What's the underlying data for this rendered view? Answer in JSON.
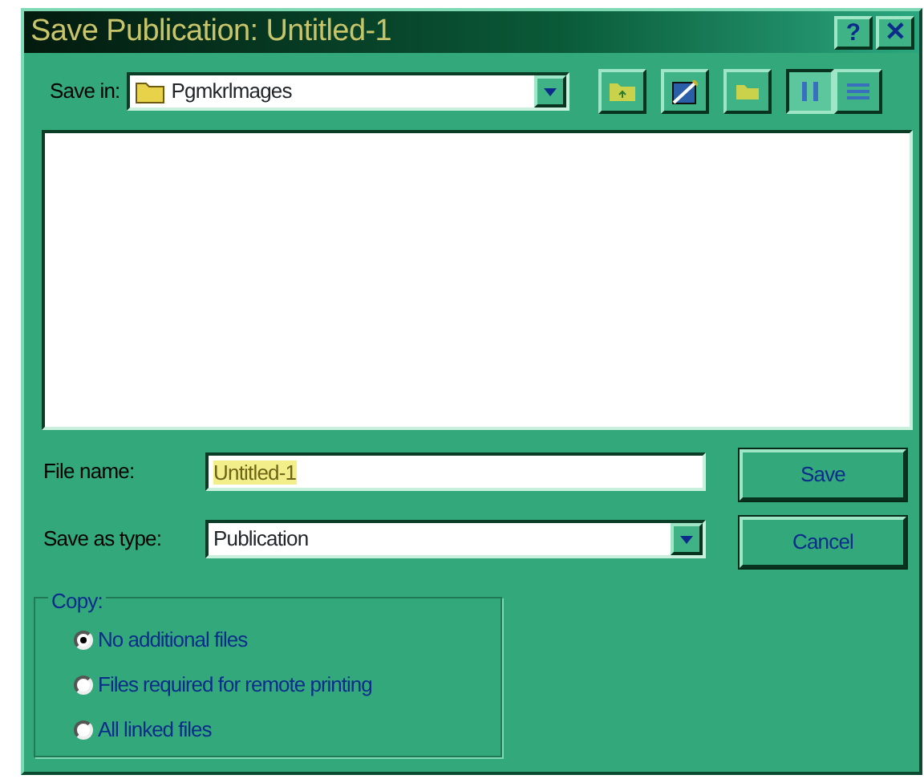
{
  "window": {
    "title": "Save Publication: Untitled-1",
    "buttons": [
      {
        "label": "?",
        "kind": "help"
      },
      {
        "label": "✕",
        "kind": "close"
      }
    ]
  },
  "save_in": {
    "label": "Save in:",
    "value": "Pgmkrlmages"
  },
  "toolbar": [
    {
      "kind": "up-folder",
      "selected": false
    },
    {
      "kind": "desktop",
      "selected": false
    },
    {
      "kind": "new-folder",
      "selected": false
    },
    {
      "kind": "list-view",
      "selected": true
    },
    {
      "kind": "details-view",
      "selected": false
    }
  ],
  "file_name": {
    "label": "File name:",
    "value": "Untitled-1"
  },
  "save_as_type": {
    "label": "Save as type:",
    "value": "Publication"
  },
  "buttons": [
    {
      "label": "Save"
    },
    {
      "label": "Cancel"
    }
  ],
  "copy": {
    "title": "Copy:",
    "options": [
      {
        "label": "No additional files",
        "selected": true
      },
      {
        "label": "Files required for remote printing",
        "selected": false
      },
      {
        "label": "All linked files",
        "selected": false
      }
    ]
  }
}
